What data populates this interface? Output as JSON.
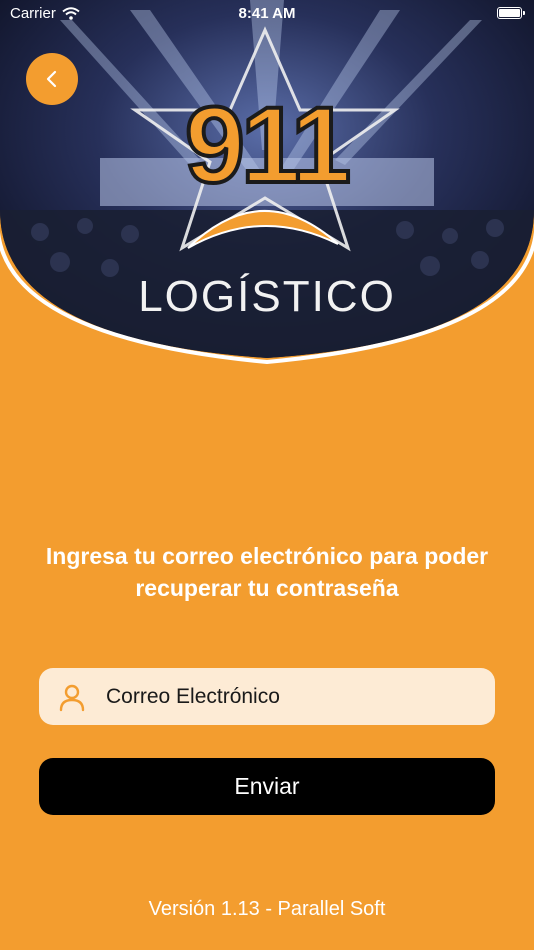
{
  "status_bar": {
    "carrier": "Carrier",
    "time": "8:41 AM",
    "icons": [
      "wifi-icon",
      "battery-icon"
    ]
  },
  "header": {
    "back_icon": "chevron-left-icon",
    "logo_number": "911",
    "logo_word": "LOGÍSTICO"
  },
  "main": {
    "instructions": "Ingresa tu correo electrónico para poder recuperar tu contraseña"
  },
  "form": {
    "email_placeholder": "Correo Electrónico",
    "email_icon": "user-icon",
    "submit_label": "Enviar"
  },
  "footer": {
    "version": "Versión 1.13 - Parallel Soft"
  },
  "colors": {
    "background": "#F39D2F",
    "field": "#FDEBD5",
    "button": "#000000",
    "text": "#FFFFFF"
  }
}
